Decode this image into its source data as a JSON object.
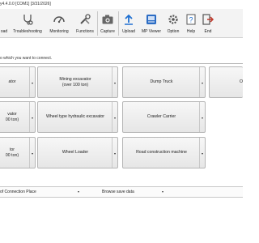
{
  "window": {
    "title": "y4.4.0.0 [COM1] [3/31/2026]"
  },
  "toolbar": {
    "buttons": [
      {
        "label": "oad",
        "icon": "download-icon"
      },
      {
        "label": "Troubleshooting",
        "icon": "stethoscope-icon"
      },
      {
        "label": "Monitoring",
        "icon": "gauge-icon"
      },
      {
        "label": "Functions",
        "icon": "tools-icon"
      },
      {
        "label": "Capture",
        "icon": "camera-icon"
      },
      {
        "label": "Upload",
        "icon": "upload-icon"
      },
      {
        "label": "MP Viewer",
        "icon": "viewer-icon"
      },
      {
        "label": "Option",
        "icon": "gear-icon"
      },
      {
        "label": "Help",
        "icon": "help-icon"
      },
      {
        "label": "End",
        "icon": "exit-icon"
      }
    ]
  },
  "instruction": "o which you want to connect.",
  "machines": {
    "row1": [
      {
        "line1": "ator",
        "line2": ""
      },
      {
        "line1": "Mining excavator",
        "line2": "(over 100 ton)"
      },
      {
        "line1": "Dump Truck",
        "line2": ""
      },
      {
        "line1": "O",
        "line2": ""
      }
    ],
    "row2": [
      {
        "line1": "vator",
        "line2": "00 ton)"
      },
      {
        "line1": "Wheel type hydraulic excavator",
        "line2": ""
      },
      {
        "line1": "Crawler Carrier",
        "line2": ""
      }
    ],
    "row3": [
      {
        "line1": "tor",
        "line2": "00 ton)"
      },
      {
        "line1": "Wheel Loader",
        "line2": ""
      },
      {
        "line1": "Road construction machine",
        "line2": ""
      }
    ]
  },
  "bottom": {
    "connection_place": "of Connection Place",
    "browse": "Browse save data"
  },
  "colors": {
    "toolbar_bg": "#f3f3f3",
    "button_bg": "#eeeeee",
    "border": "#b5b5b5"
  }
}
